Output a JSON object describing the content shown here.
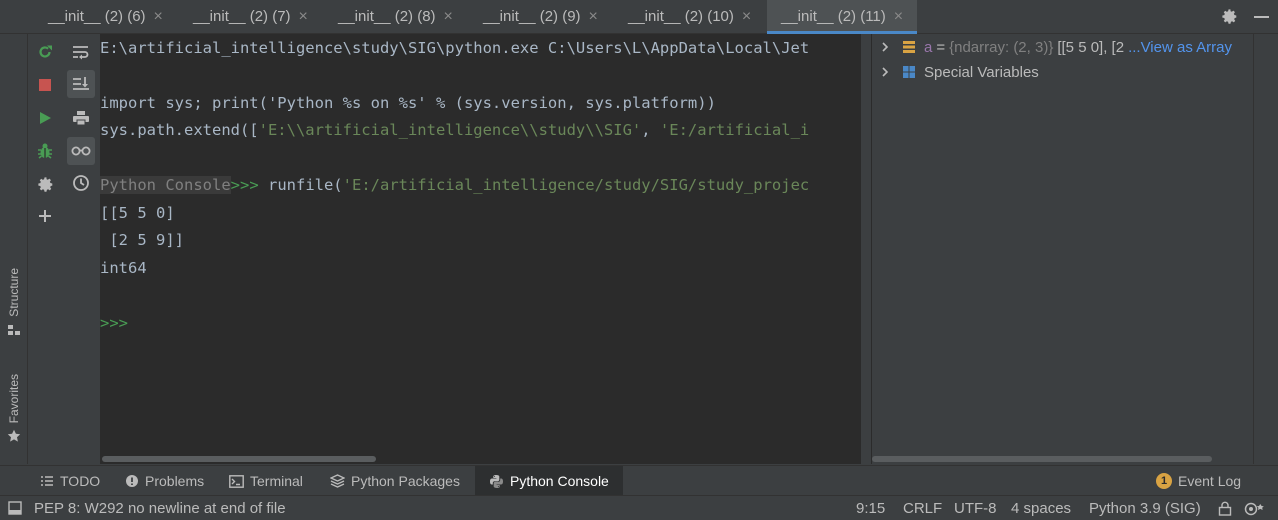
{
  "tabs": [
    {
      "label": "__init__ (2) (6)",
      "active": false
    },
    {
      "label": "__init__ (2) (7)",
      "active": false
    },
    {
      "label": "__init__ (2) (8)",
      "active": false
    },
    {
      "label": "__init__ (2) (9)",
      "active": false
    },
    {
      "label": "__init__ (2) (10)",
      "active": false
    },
    {
      "label": "__init__ (2) (11)",
      "active": true
    }
  ],
  "tab_close_glyph": "×",
  "tabbar_icons": [
    "gear-icon",
    "minimize-icon"
  ],
  "left_strip": {
    "structure_label": "Structure",
    "favorites_label": "Favorites"
  },
  "toolbar_left_icons": [
    "rerun-icon",
    "stop-icon",
    "run-icon",
    "debug-icon",
    "settings-icon",
    "add-icon"
  ],
  "toolbar_right_icons": [
    "soft-wrap-icon",
    "scroll-to-end-icon",
    "print-icon",
    "show-variables-icon",
    "history-icon"
  ],
  "console": {
    "line1": "E:\\artificial_intelligence\\study\\SIG\\python.exe C:\\Users\\L\\AppData\\Local\\Jet",
    "line2": "import sys; print('Python %s on %s' % (sys.version, sys.platform))",
    "line3_pre": "sys.path.extend([",
    "line3_str1": "'E:\\\\artificial_intelligence\\\\study\\\\SIG'",
    "line3_mid": ", ",
    "line3_str2": "'E:/artificial_i",
    "prompt_label": "Python Console",
    "prompt_arrows": ">>>",
    "cmd_pre": " runfile(",
    "cmd_str": "'E:/artificial_intelligence/study/SIG/study_projec",
    "out1": "[[5 5 0]",
    "out2": " [2 5 9]]",
    "out3": "int64",
    "final_prompt": ">>>"
  },
  "variables": {
    "var_a_name": "a",
    "var_a_eq": "=",
    "var_a_type": "{ndarray: (2, 3)}",
    "var_a_value": "[[5 5 0], [2",
    "var_a_link": "...View as Array",
    "special_label": "Special Variables"
  },
  "bottom_tools": [
    {
      "label": "TODO",
      "icon": "list-icon"
    },
    {
      "label": "Problems",
      "icon": "problems-icon"
    },
    {
      "label": "Terminal",
      "icon": "terminal-icon"
    },
    {
      "label": "Python Packages",
      "icon": "packages-icon"
    },
    {
      "label": "Python Console",
      "icon": "python-icon",
      "active": true
    }
  ],
  "event_log": {
    "count": "1",
    "label": "Event Log"
  },
  "status": {
    "message": "PEP 8: W292 no newline at end of file",
    "position": "9:15",
    "line_sep": "CRLF",
    "encoding": "UTF-8",
    "indent": "4 spaces",
    "interpreter": "Python 3.9 (SIG)"
  },
  "colors": {
    "accent": "#4a88c7",
    "prompt_green": "#499c54",
    "string_green": "#6a8759",
    "var_purple": "#9876aa",
    "link_blue": "#5394ec",
    "stop_red": "#c75450"
  }
}
